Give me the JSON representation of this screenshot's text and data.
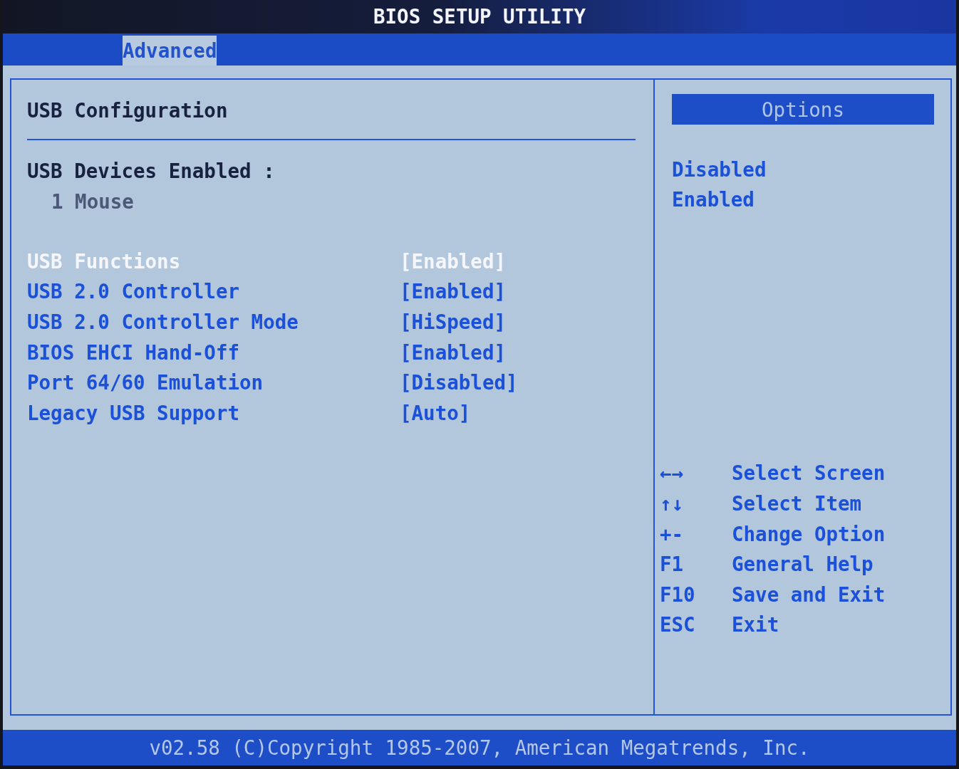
{
  "window": {
    "title": "BIOS SETUP UTILITY"
  },
  "tabs": [
    {
      "label": "Advanced",
      "selected": true
    }
  ],
  "main_panel": {
    "heading": "USB Configuration",
    "devices_label": "USB Devices Enabled :",
    "devices": [
      "1 Mouse"
    ],
    "settings": [
      {
        "name": "USB Functions",
        "value": "[Enabled]",
        "selected": true
      },
      {
        "name": "USB 2.0 Controller",
        "value": "[Enabled]",
        "selected": false
      },
      {
        "name": "USB 2.0 Controller Mode",
        "value": "[HiSpeed]",
        "selected": false
      },
      {
        "name": "BIOS EHCI Hand-Off",
        "value": "[Enabled]",
        "selected": false
      },
      {
        "name": "Port 64/60 Emulation",
        "value": "[Disabled]",
        "selected": false
      },
      {
        "name": "Legacy USB Support",
        "value": "[Auto]",
        "selected": false
      }
    ]
  },
  "help_panel": {
    "options_title": "Options",
    "options": [
      "Disabled",
      "Enabled"
    ],
    "keys": [
      {
        "key": "←→",
        "action": "Select Screen"
      },
      {
        "key": "↑↓",
        "action": "Select Item"
      },
      {
        "key": "+-",
        "action": "Change Option"
      },
      {
        "key": "F1",
        "action": "General Help"
      },
      {
        "key": "F10",
        "action": "Save and Exit"
      },
      {
        "key": "ESC",
        "action": "Exit"
      }
    ]
  },
  "status_bar": {
    "text": "v02.58 (C)Copyright 1985-2007, American Megatrends, Inc."
  }
}
